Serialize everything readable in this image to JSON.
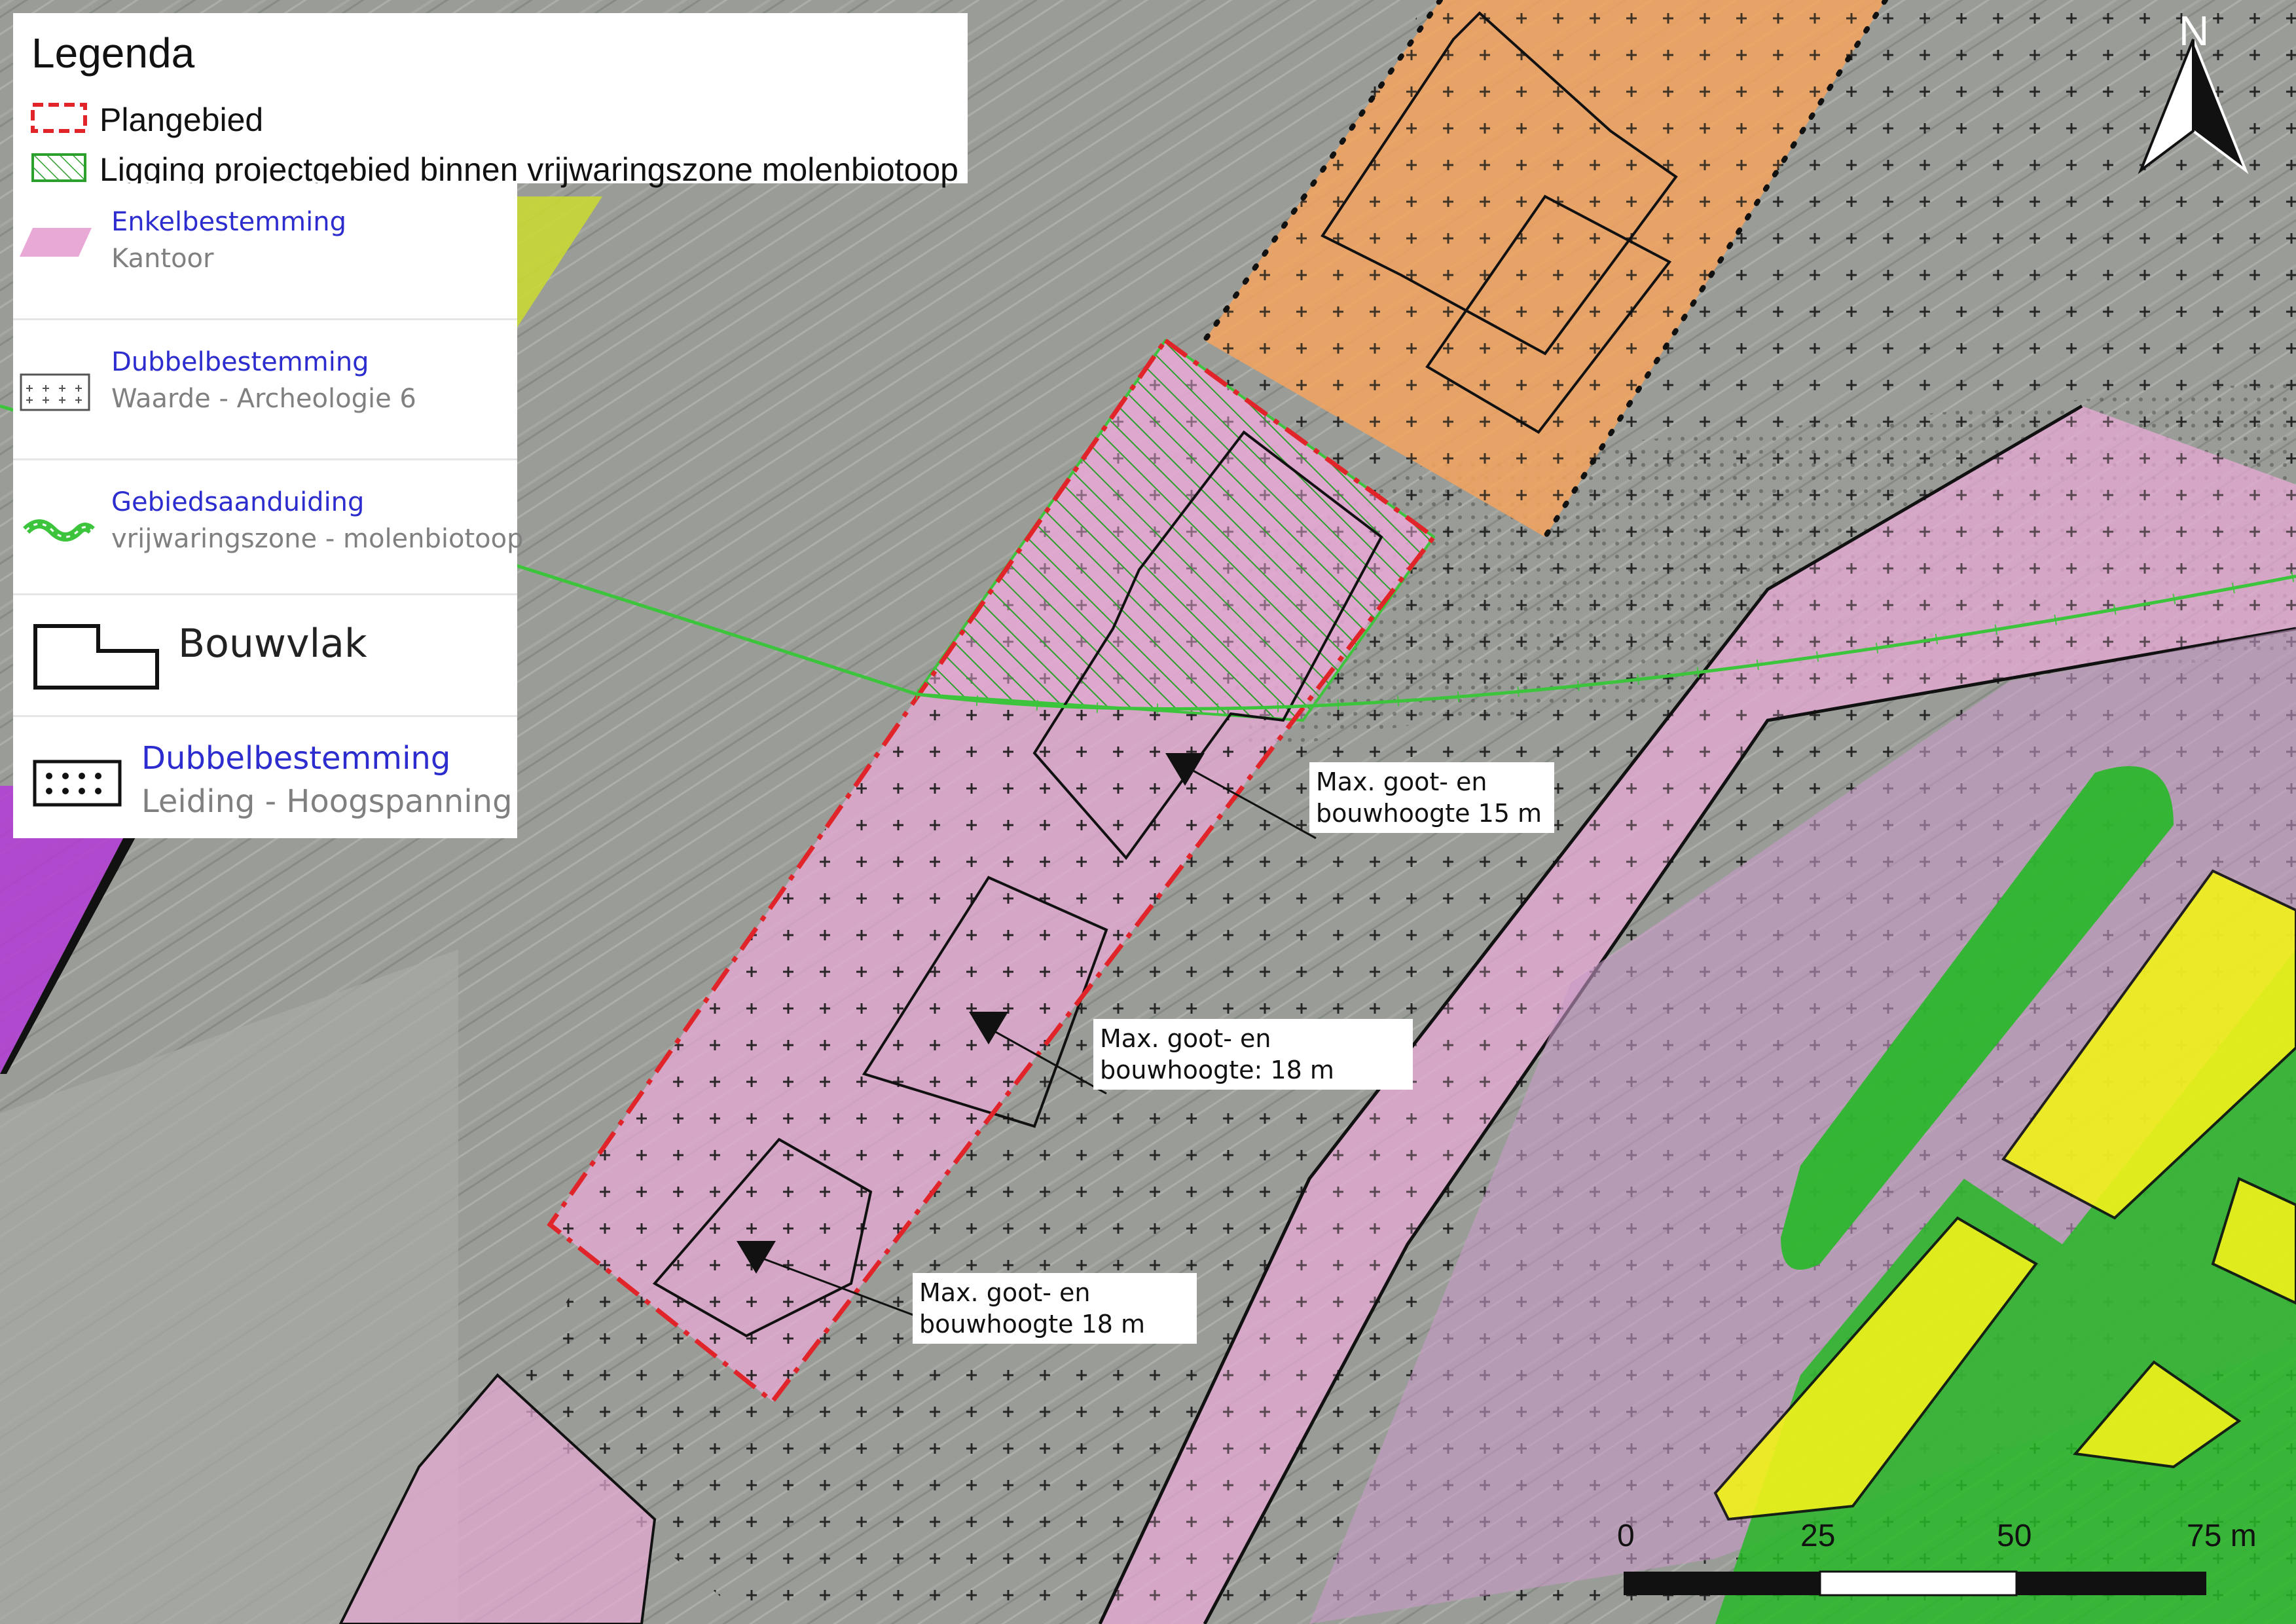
{
  "legend": {
    "title": "Legenda",
    "plangebied": "Plangebied",
    "ligging": "Ligging projectgebied binnen vrijwaringszone molenbiotoop",
    "enkel_title": "Enkelbestemming",
    "enkel_sub": "Kantoor",
    "dubbel_title": "Dubbelbestemming",
    "dubbel_sub": "Waarde - Archeologie 6",
    "gebied_title": "Gebiedsaanduiding",
    "gebied_sub": "vrijwaringszone - molenbiotoop",
    "bouwvlak": "Bouwvlak",
    "dubbel2_title": "Dubbelbestemming",
    "dubbel2_sub": "Leiding - Hoogspanning"
  },
  "labels": {
    "l1_line1": "Max. goot- en",
    "l1_line2": "bouwhoogte 15 m",
    "l2_line1": "Max. goot- en",
    "l2_line2": "bouwhoogte: 18 m",
    "l3_line1": "Max. goot- en",
    "l3_line2": "bouwhoogte 18 m"
  },
  "scale": {
    "s0": "0",
    "s25": "25",
    "s50": "50",
    "s75": "75 m"
  },
  "north": "N",
  "colors": {
    "kantoor": "#e8a9d6",
    "gemengd": "#f5a35e",
    "groen": "#27b827",
    "wonen": "#f2f21a",
    "plangebied": "#e0242a",
    "molenzone": "#3cc43c",
    "verkeer": "#b33bd6"
  }
}
